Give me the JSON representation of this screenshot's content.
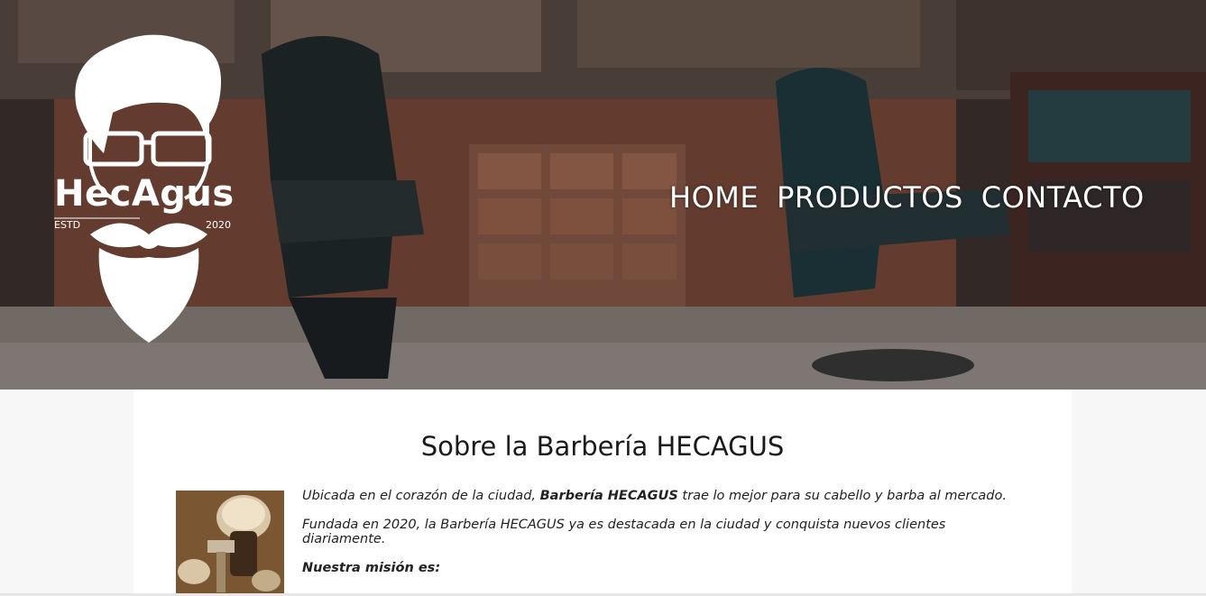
{
  "logo": {
    "name": "HecAgus",
    "estd": "ESTD",
    "year": "2020"
  },
  "nav": {
    "items": [
      {
        "label": "HOME"
      },
      {
        "label": "PRODUCTOS"
      },
      {
        "label": "CONTACTO"
      }
    ]
  },
  "main": {
    "title": "Sobre la Barbería HECAGUS",
    "paragraph1": {
      "before": "Ubicada en el corazón de la ciudad, ",
      "bold": "Barbería HECAGUS",
      "after": " trae lo mejor para su cabello y barba al mercado."
    },
    "paragraph2": "Fundada en 2020, la Barbería HECAGUS ya es destacada en la ciudad y conquista nuevos clientes diariamente.",
    "mission_label": "Nuestra misión es:"
  },
  "colors": {
    "hero_dark": "#3a2e2a",
    "text": "#1a1a1a",
    "white": "#ffffff"
  }
}
